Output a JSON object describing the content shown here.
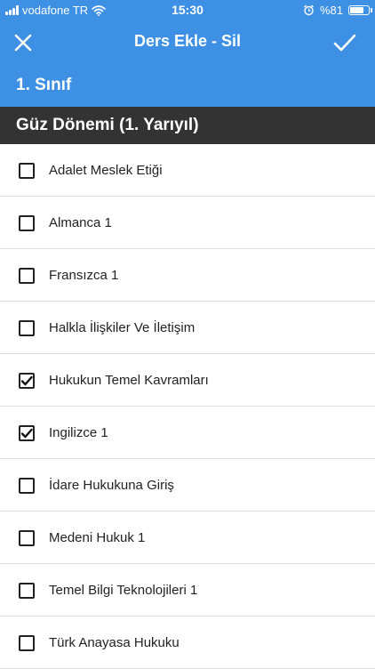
{
  "status_bar": {
    "carrier": "vodafone TR",
    "time": "15:30",
    "battery_text": "%81",
    "battery_level": 0.81
  },
  "nav": {
    "title": "Ders Ekle - Sil",
    "close_icon": "close-icon",
    "confirm_icon": "checkmark-icon"
  },
  "class_header": "1. Sınıf",
  "semester_header": "Güz Dönemi (1. Yarıyıl)",
  "courses": [
    {
      "label": "Adalet Meslek Etiği",
      "checked": false
    },
    {
      "label": "Almanca 1",
      "checked": false
    },
    {
      "label": "Fransızca 1",
      "checked": false
    },
    {
      "label": "Halkla İlişkiler Ve İletişim",
      "checked": false
    },
    {
      "label": "Hukukun Temel Kavramları",
      "checked": true
    },
    {
      "label": "Ingilizce 1",
      "checked": true
    },
    {
      "label": "İdare Hukukuna Giriş",
      "checked": false
    },
    {
      "label": "Medeni Hukuk 1",
      "checked": false
    },
    {
      "label": "Temel Bilgi Teknolojileri 1",
      "checked": false
    },
    {
      "label": "Türk Anayasa Hukuku",
      "checked": false
    }
  ],
  "colors": {
    "primary": "#3d90e3",
    "section_dark": "#333333",
    "divider": "#dcdcdc"
  }
}
